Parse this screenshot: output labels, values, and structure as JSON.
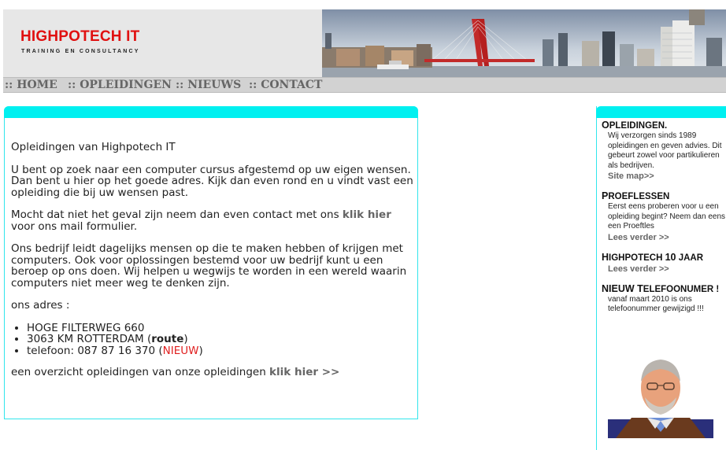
{
  "header": {
    "title": "HIGHPOTECH IT",
    "subtitle": "TRAINING EN CONSULTANCY"
  },
  "nav": [
    {
      "label": ":: HOME"
    },
    {
      "label": ":: OPLEIDINGEN"
    },
    {
      "label": ":: NIEUWS"
    },
    {
      "label": ":: CONTACT"
    }
  ],
  "main": {
    "heading": "Opleidingen van Highpotech IT",
    "p1": "U bent op zoek naar een computer cursus afgestemd op uw eigen wensen.",
    "p1b": "Dan bent u hier op het goede adres. Kijk dan even rond en u vindt vast een opleiding die bij uw wensen past.",
    "p2_pre": "Mocht dat niet het geval zijn neem dan even contact met ons ",
    "p2_link": "klik hier",
    "p2_post": " voor ons mail formulier.",
    "p3": "Ons bedrijf leidt dagelijks mensen op die te maken hebben of krijgen met computers. Ook voor oplossingen bestemd voor uw bedrijf kunt u een beroep op ons doen. Wij helpen u wegwijs te worden in een wereld waarin computers niet meer weg te denken zijn.",
    "address_label": "ons adres :",
    "address": {
      "street": "HOGE FILTERWEG 660",
      "city_pre": "3063 KM ROTTERDAM (",
      "route": "route",
      "city_post": ")",
      "phone_pre": "telefoon: 087 87 16 370 (",
      "nieuw": "NIEUW",
      "phone_post": ")"
    },
    "overview_pre": "een overzicht opleidingen van onze opleidingen ",
    "overview_link": "klik hier >>"
  },
  "sidebar": {
    "s1": {
      "h_first": "O",
      "h_rest": "PLEIDINGEN.",
      "body": "Wij verzorgen sinds 1989 opleidingen en geven advies. Dit gebeurt zowel voor partikulieren als bedrijven.",
      "link": "Site map>>"
    },
    "s2": {
      "h_first": "P",
      "h_rest": "ROEFLESSEN",
      "body": "Eerst eens proberen voor u een opleiding begint? Neem dan eens een Proeftles",
      "link": "Lees verder >>"
    },
    "s3": {
      "h_first": "H",
      "h_rest": "IGHPOTECH ",
      "h_num": "10",
      "h_tail": " JAAR",
      "link": "Lees verder >>"
    },
    "s4": {
      "h_first": "NIEUW T",
      "h_rest": "ELEFOONUMER !",
      "body": "vanaf maart 2010 is ons telefoonummer gewijzigd !!!"
    }
  },
  "colors": {
    "accent": "#00f0f0",
    "brand_red": "#e01010",
    "nav_bg": "#d2d2d2",
    "link_gray": "#666666"
  }
}
